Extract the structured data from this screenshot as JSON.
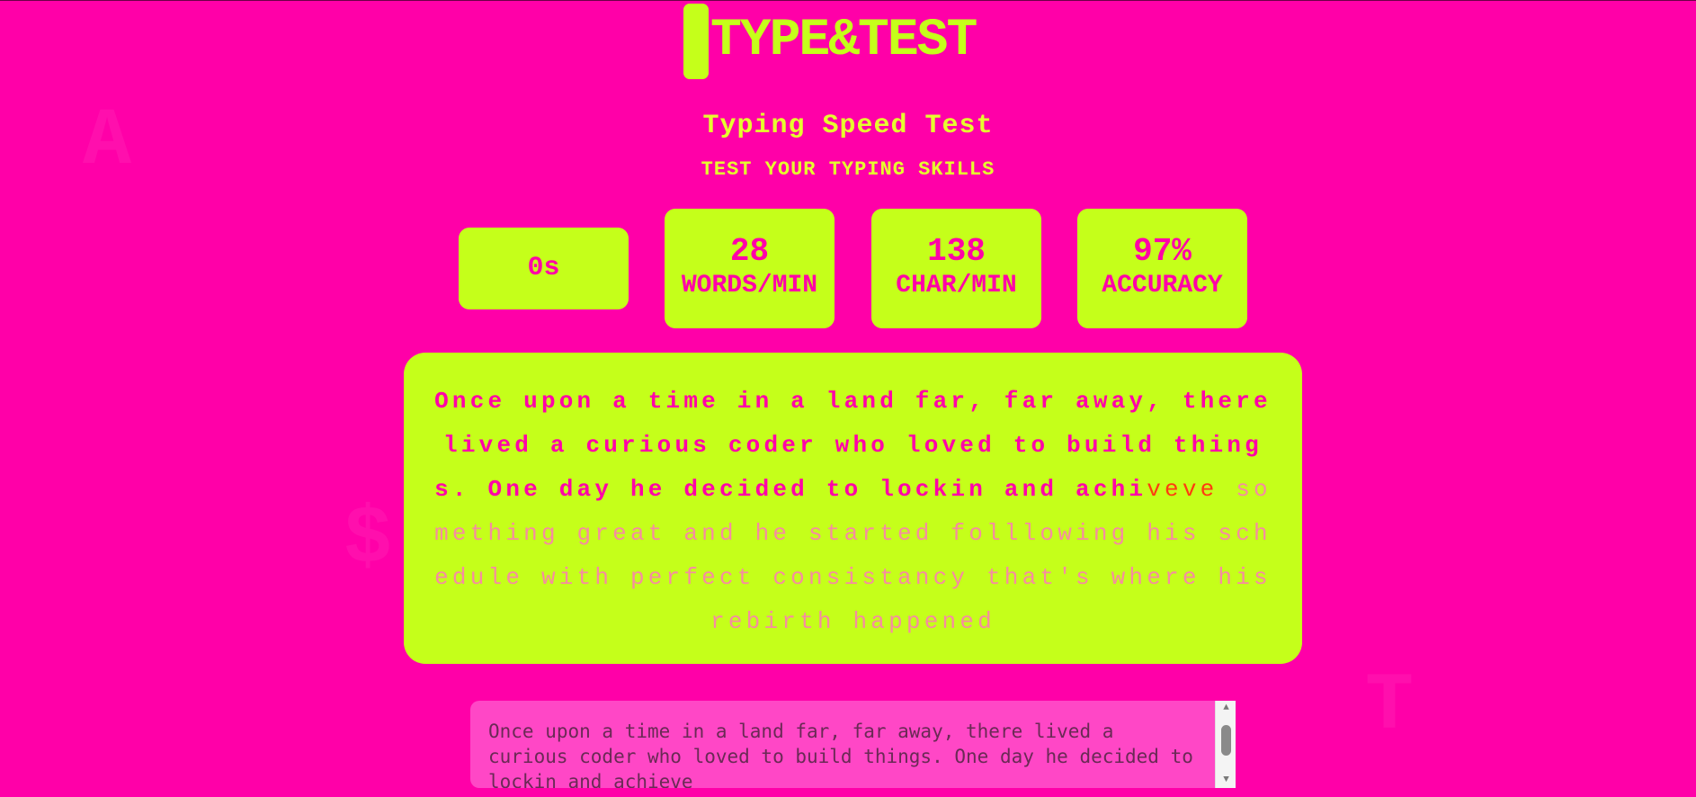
{
  "header": {
    "logo_text": "TYPE&TEST",
    "title": "Typing Speed Test",
    "subtitle": "TEST YOUR TYPING SKILLS"
  },
  "background_glyphs": [
    "A",
    "$",
    "T"
  ],
  "stats": {
    "timer": "0s",
    "wpm_value": "28",
    "wpm_label": "WORDS/MIN",
    "cpm_value": "138",
    "cpm_label": "CHAR/MIN",
    "accuracy_value": "97%",
    "accuracy_label": "ACCURACY"
  },
  "passage": {
    "typed": "Once upon a time in a land far, far away, there lived a curious coder who loved to build things. One day he decided to lockin and achi",
    "current": "veve",
    "pending": " something great and he started folllowing his schedule with perfect consistancy that's where his rebirth happened"
  },
  "input": {
    "value": "Once upon a time in a land far, far away, there lived a curious coder who loved to build things. One day he decided to lockin and achieve"
  },
  "colors": {
    "background": "#ff00a8",
    "accent": "#c5ff1a",
    "title_text": "#e6ff2e",
    "current_char": "#ff3b10"
  },
  "icons": {
    "scroll_up": "scroll-up-arrow-icon",
    "scroll_down": "scroll-down-arrow-icon"
  }
}
